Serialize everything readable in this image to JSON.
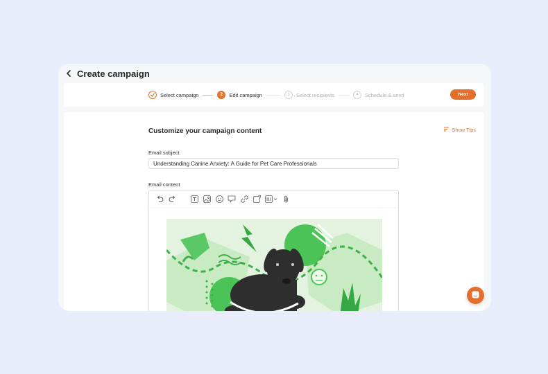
{
  "header": {
    "title": "Create campaign"
  },
  "stepper": {
    "steps": [
      {
        "number": "",
        "label": "Select campaign",
        "state": "done"
      },
      {
        "number": "2",
        "label": "Edit campaign",
        "state": "active"
      },
      {
        "number": "3",
        "label": "Select recipients",
        "state": "todo"
      },
      {
        "number": "4",
        "label": "Schedule & send",
        "state": "todo"
      }
    ],
    "next_label": "Next"
  },
  "content": {
    "title": "Customize your campaign content",
    "show_tips_label": "Show Tips",
    "subject_label": "Email subject",
    "subject_value": "Understanding Canine Anxiety: A Guide for Pet Care Professionals",
    "content_label": "Email content"
  },
  "toolbar": {
    "icons": [
      "undo-icon",
      "redo-icon",
      "text-icon",
      "image-icon",
      "emoji-icon",
      "speech-bubble-icon",
      "link-icon",
      "edit-box-icon",
      "variable-icon",
      "attachment-icon"
    ]
  },
  "colors": {
    "accent": "#e36f2c",
    "green": "#3fbf4a",
    "bg": "#e9ecfa"
  }
}
